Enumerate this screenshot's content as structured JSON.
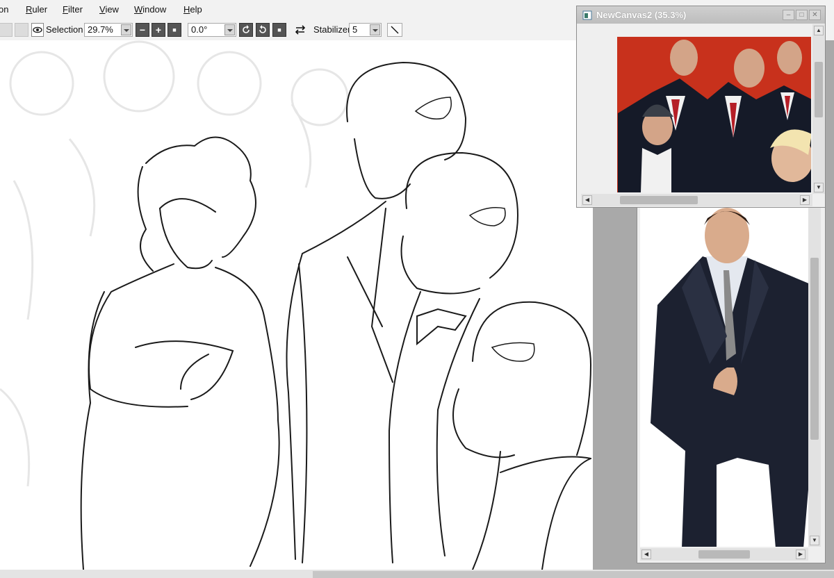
{
  "menu": {
    "items": [
      {
        "label": "on",
        "hotkey": ""
      },
      {
        "label": "Ruler",
        "hotkey": "R"
      },
      {
        "label": "Filter",
        "hotkey": "F"
      },
      {
        "label": "View",
        "hotkey": "V"
      },
      {
        "label": "Window",
        "hotkey": "W"
      },
      {
        "label": "Help",
        "hotkey": "H"
      }
    ]
  },
  "toolbar": {
    "selection_label": "Selection",
    "zoom_value": "29.7%",
    "zoom_out": "−",
    "zoom_in": "+",
    "zoom_reset": "■",
    "rotation_value": "0.0°",
    "rotate_reset": "■",
    "stabilizer_label": "Stabilizer",
    "stabilizer_value": "5"
  },
  "reference_window": {
    "title": "NewCanvas2 (35.3%)"
  },
  "colors": {
    "chrome": "#f2f2f2",
    "panel_bg": "#a9a9a9",
    "photo_red": "#c8311c",
    "suit_navy": "#1c2130"
  }
}
